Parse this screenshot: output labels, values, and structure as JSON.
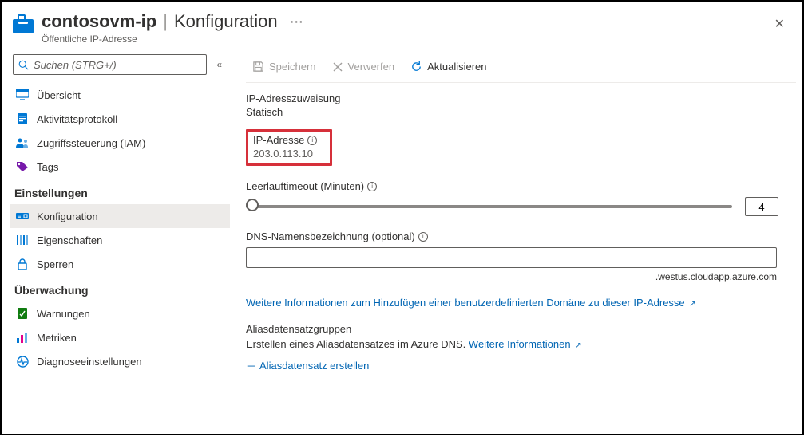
{
  "header": {
    "resource_name": "contosovm-ip",
    "page_name": "Konfiguration",
    "more": "···",
    "subtitle": "Öffentliche IP-Adresse"
  },
  "sidebar": {
    "search_placeholder": "Suchen (STRG+/)",
    "items": {
      "overview": "Übersicht",
      "activity": "Aktivitätsprotokoll",
      "iam": "Zugriffssteuerung (IAM)",
      "tags": "Tags"
    },
    "section_settings": "Einstellungen",
    "settings": {
      "configuration": "Konfiguration",
      "properties": "Eigenschaften",
      "locks": "Sperren"
    },
    "section_monitoring": "Überwachung",
    "monitoring": {
      "alerts": "Warnungen",
      "metrics": "Metriken",
      "diagnostics": "Diagnoseeinstellungen"
    }
  },
  "toolbar": {
    "save": "Speichern",
    "discard": "Verwerfen",
    "refresh": "Aktualisieren"
  },
  "content": {
    "assignment_label": "IP-Adresszuweisung",
    "assignment_value": "Statisch",
    "ip_label": "IP-Adresse",
    "ip_value": "203.0.113.10",
    "timeout_label": "Leerlauftimeout (Minuten)",
    "timeout_value": "4",
    "dns_label": "DNS-Namensbezeichnung (optional)",
    "dns_value": "",
    "dns_suffix": ".westus.cloudapp.azure.com",
    "custom_domain_link": "Weitere Informationen zum Hinzufügen einer benutzerdefinierten Domäne zu dieser IP-Adresse",
    "alias_heading": "Aliasdatensatzgruppen",
    "alias_desc_prefix": "Erstellen eines Aliasdatensatzes im Azure DNS. ",
    "alias_more_info": "Weitere Informationen",
    "alias_create": "Aliasdatensatz erstellen"
  }
}
